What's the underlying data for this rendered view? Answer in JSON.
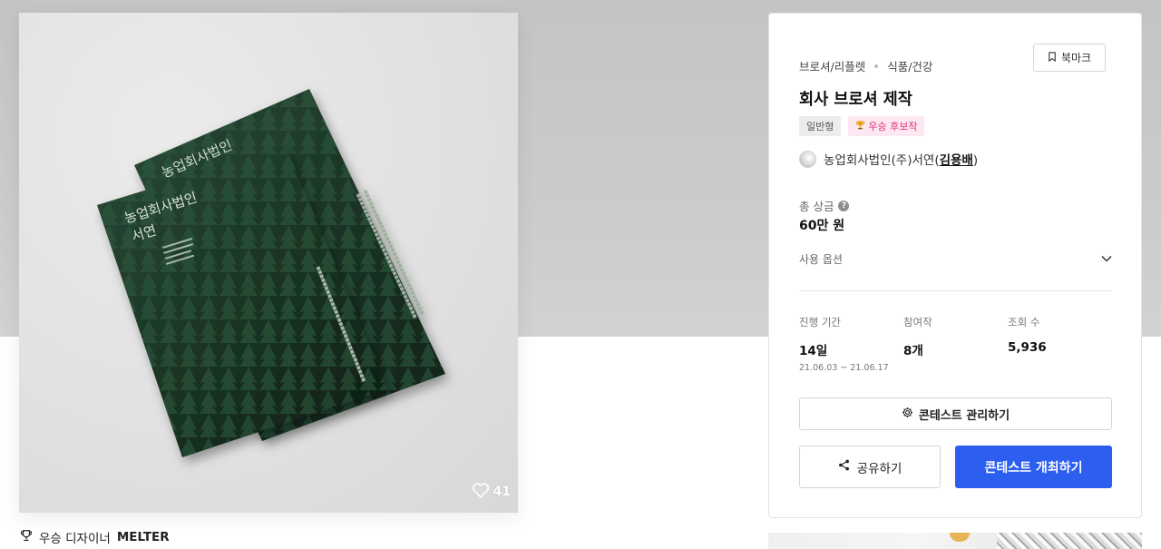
{
  "hero": {
    "brochure_title_line1": "농업회사법인",
    "brochure_title_line2": "서연",
    "likes_count": "41",
    "winner_prefix": "우승 디자이너",
    "winner_name": "MELTER"
  },
  "contest": {
    "category": "브로셔/리플렛",
    "subcategory": "식품/건강",
    "bookmark_label": "북마크",
    "title": "회사 브로셔 제작",
    "badge_type": "일반형",
    "badge_candidate": "우승 후보작",
    "host_company": "농업회사법인(주)서연(",
    "host_user": "김용배",
    "host_close": ")",
    "prize_label": "총 상금",
    "prize_value": "60만 원",
    "use_options_label": "사용 옵션"
  },
  "stats": {
    "period_label": "진행 기간",
    "period_value": "14일",
    "period_range": "21.06.03 ~ 21.06.17",
    "entries_label": "참여작",
    "entries_value": "8개",
    "views_label": "조회 수",
    "views_value": "5,936"
  },
  "actions": {
    "manage_label": "콘테스트 관리하기",
    "share_label": "공유하기",
    "host_label": "콘테스트 개최하기"
  },
  "colors": {
    "primary": "#2c5ef0",
    "candidate_badge_text": "#e0317a",
    "candidate_badge_bg": "#fde7f1",
    "brochure_green": "#1f3a2a"
  },
  "icons": [
    "heart-icon",
    "trophy-icon",
    "bookmark-icon",
    "help-icon",
    "chevron-down-icon",
    "gear-icon",
    "share-icon"
  ]
}
